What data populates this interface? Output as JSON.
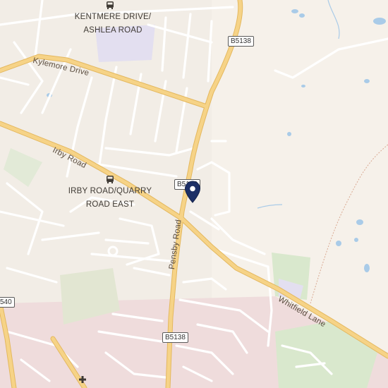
{
  "roads": {
    "kylemore": "Kylemore Drive",
    "irby": "Irby Road",
    "pensby": "Pensby Road",
    "whitfield": "Whitfield Lane"
  },
  "shields": {
    "top": "B5138",
    "middle": "B5138",
    "bottom": "B5138",
    "left": "540"
  },
  "places": {
    "kentmere_line1": "KENTMERE DRIVE/",
    "kentmere_line2": "ASHLEA ROAD",
    "irby_line1": "IRBY ROAD/QUARRY",
    "irby_line2": "ROAD EAST"
  },
  "colors": {
    "major_road": "#f6d387",
    "major_road_casing": "#e4b85f",
    "minor_road": "#ffffff",
    "water": "#a9cbe8",
    "park": "#d9e8cd",
    "urban_pink": "#efdcdc",
    "school": "#e3dff0",
    "pin": "#1c2f66"
  },
  "icons": {
    "bus_stop_1": "bus-icon",
    "bus_stop_2": "bus-icon",
    "hospital": "medical-cross-icon",
    "marker": "location-pin-icon"
  }
}
